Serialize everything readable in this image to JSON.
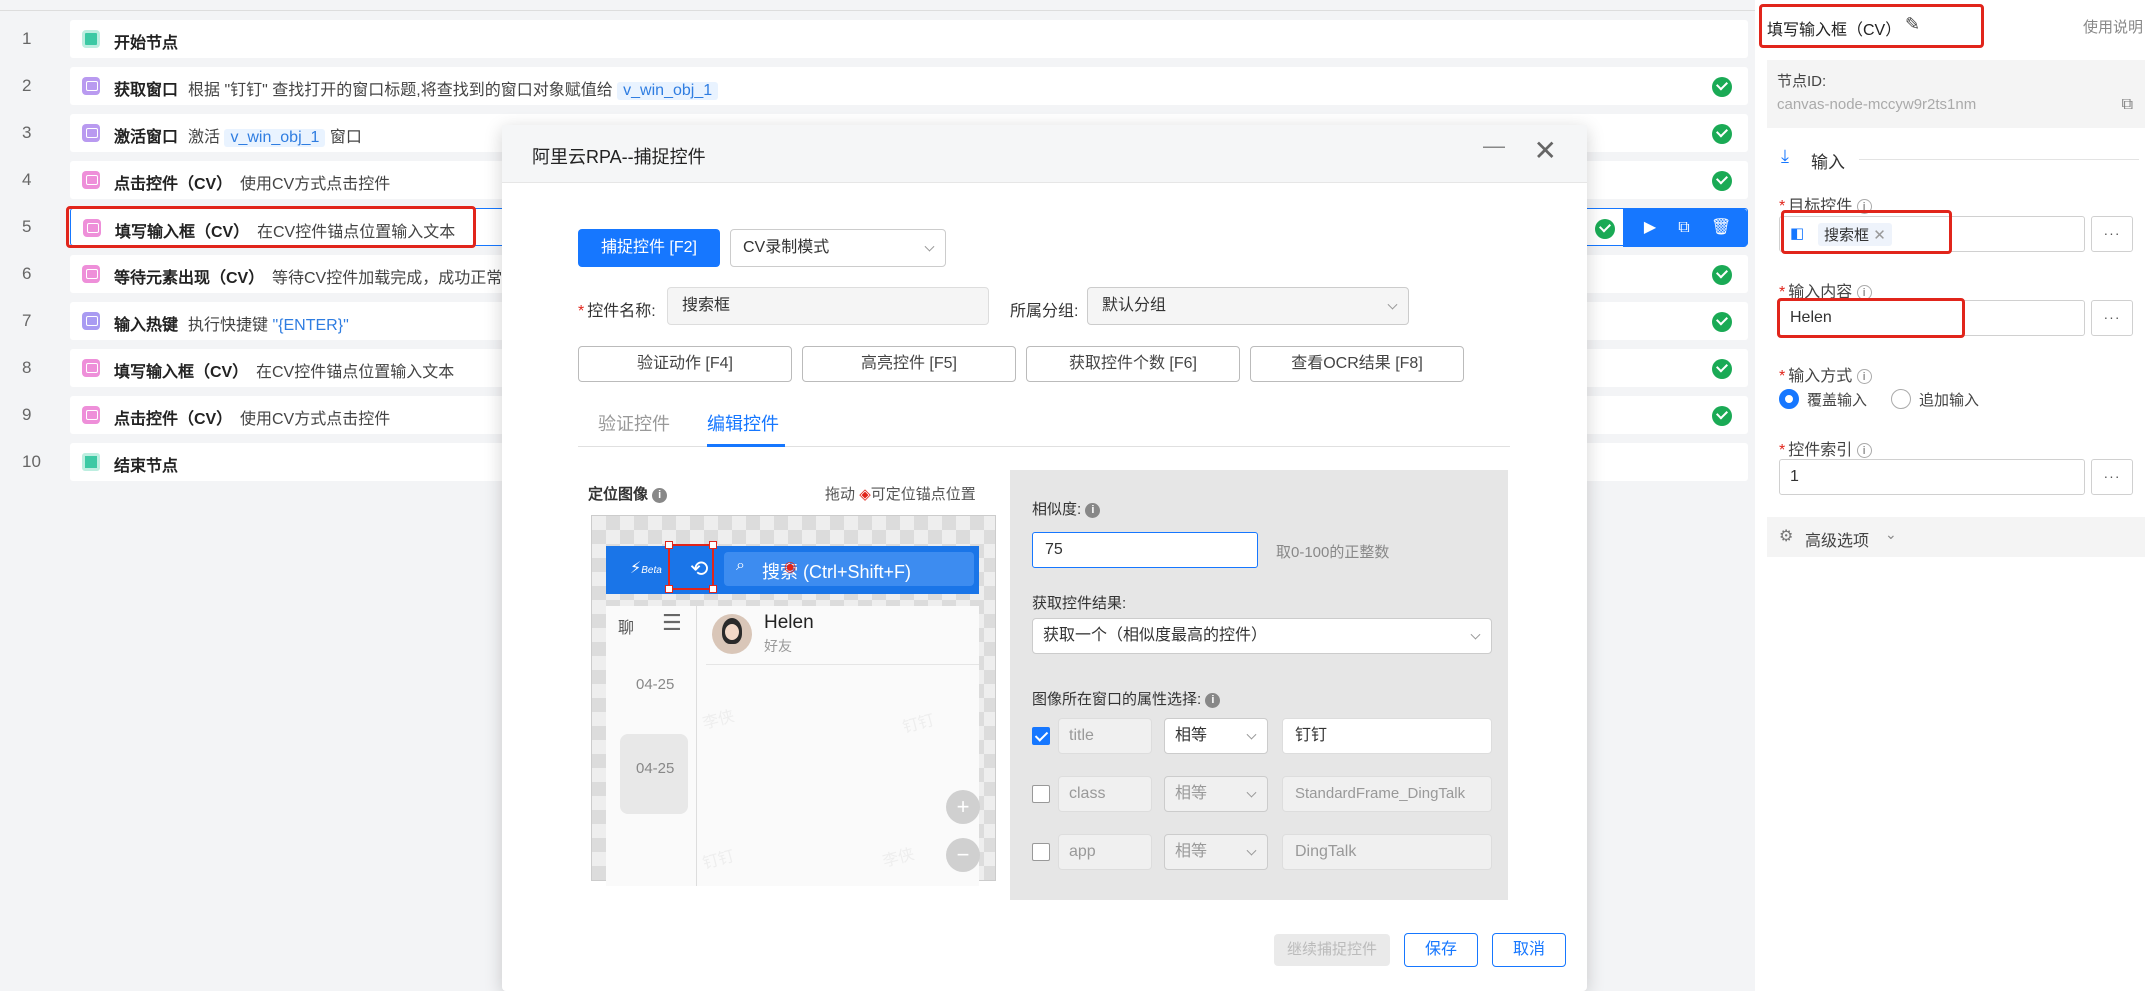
{
  "flow": {
    "rows": [
      {
        "num": "1",
        "title": "开始节点",
        "icon": "start-node-icon"
      },
      {
        "num": "2",
        "title": "获取窗口",
        "desc_pre": "根据 \"钉钉\" 查找打开的窗口标题,将查找到的窗口对象赋值给",
        "var": "v_win_obj_1",
        "status": "success"
      },
      {
        "num": "3",
        "title": "激活窗口",
        "desc_pre": "激活",
        "var": "v_win_obj_1",
        "desc_post": "窗口",
        "status": "success"
      },
      {
        "num": "4",
        "title": "点击控件（CV）",
        "desc_pre": "使用CV方式点击控件",
        "status": "success"
      },
      {
        "num": "5",
        "title": "填写输入框（CV）",
        "desc_pre": "在CV控件锚点位置输入文本",
        "status": "success"
      },
      {
        "num": "6",
        "title": "等待元素出现（CV）",
        "desc_pre": "等待CV控件加载完成，成功正常",
        "status": "success"
      },
      {
        "num": "7",
        "title": "输入热键",
        "desc_pre": "执行快捷键",
        "var": "\"{ENTER}\"",
        "status": "success"
      },
      {
        "num": "8",
        "title": "填写输入框（CV）",
        "desc_pre": "在CV控件锚点位置输入文本",
        "status": "success"
      },
      {
        "num": "9",
        "title": "点击控件（CV）",
        "desc_pre": "使用CV方式点击控件",
        "status": "success"
      },
      {
        "num": "10",
        "title": "结束节点",
        "icon": "end-node-icon"
      }
    ]
  },
  "dialog": {
    "title": "阿里云RPA--捕捉控件",
    "capture_button": "捕捉控件 [F2]",
    "mode_select": "CV录制模式",
    "name_label": "控件名称:",
    "name_value": "搜索框",
    "group_label": "所属分组:",
    "group_value": "默认分组",
    "actions": [
      "验证动作 [F4]",
      "高亮控件 [F5]",
      "获取控件个数 [F6]",
      "查看OCR结果 [F8]"
    ],
    "tabs": [
      "验证控件",
      "编辑控件"
    ],
    "active_tab": "编辑控件",
    "locate_image_label": "定位图像",
    "drag_hint_pre": "拖动",
    "drag_hint_post": "可定位锚点位置",
    "preview": {
      "search_text": "搜索 (Ctrl+Shift+F)",
      "contact_name": "Helen",
      "contact_sub": "好友",
      "date1": "04-25",
      "date2": "04-25",
      "chat_short": "聊",
      "beta": "Beta",
      "watermarks": [
        "李侠",
        "钉钉",
        "钉钉",
        "李侠"
      ]
    },
    "similarity_label": "相似度:",
    "similarity_value": "75",
    "similarity_hint": "取0-100的正整数",
    "result_label": "获取控件结果:",
    "result_value": "获取一个（相似度最高的控件）",
    "attr_label": "图像所在窗口的属性选择:",
    "attributes": [
      {
        "name": "title",
        "op": "相等",
        "value": "钉钉",
        "checked": true
      },
      {
        "name": "class",
        "op": "相等",
        "value": "StandardFrame_DingTalk",
        "checked": false
      },
      {
        "name": "app",
        "op": "相等",
        "value": "DingTalk",
        "checked": false
      }
    ],
    "continue_button": "继续捕捉控件",
    "save_button": "保存",
    "cancel_button": "取消"
  },
  "props": {
    "title": "填写输入框（CV）",
    "help": "使用说明",
    "node_id_label": "节点ID:",
    "node_id": "canvas-node-mccyw9r2ts1nm",
    "section_input": "输入",
    "target_label": "目标控件",
    "target_value": "搜索框",
    "content_label": "输入内容",
    "content_value": "Helen",
    "mode_label": "输入方式",
    "mode_options": [
      "覆盖输入",
      "追加输入"
    ],
    "index_label": "控件索引",
    "index_value": "1",
    "advanced": "高级选项"
  },
  "colors": {
    "accent": "#1677ff",
    "success": "#1aaa55",
    "highlight": "#e1251b"
  }
}
